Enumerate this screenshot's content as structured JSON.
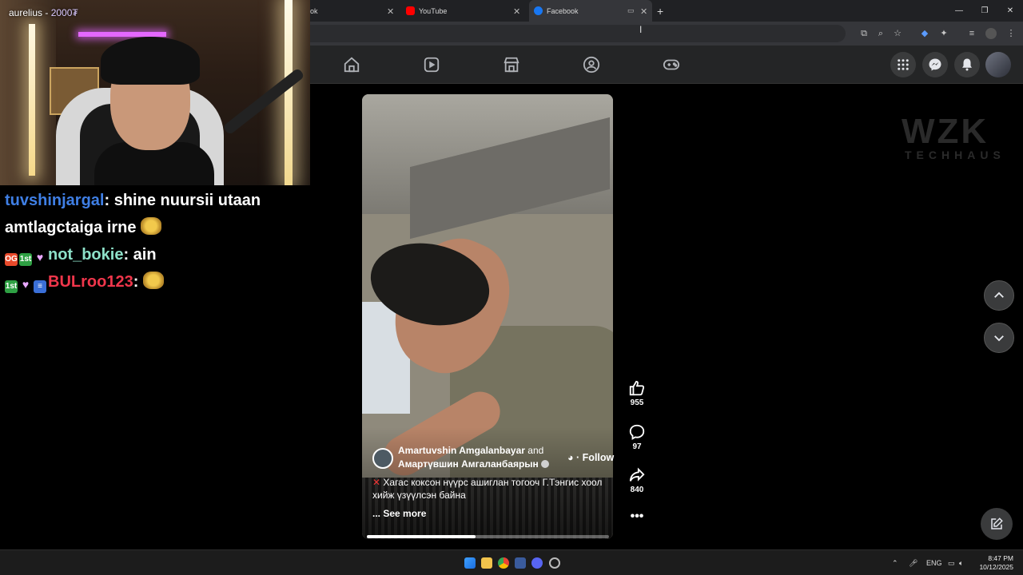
{
  "stream": {
    "cam_title_name": "aurelius - ",
    "cam_title_amount": "2000₮",
    "chat": [
      {
        "user": "tuvshinjargal",
        "message": " shine nuursii utaan",
        "continuation": "amtlagctaiga irne"
      },
      {
        "badges": [
          "OG",
          "1st"
        ],
        "user": "not_bokie",
        "message": " ain"
      },
      {
        "badges": [
          "1st"
        ],
        "user": "BULroo123",
        "message": ""
      }
    ]
  },
  "browser": {
    "tabs": [
      {
        "label": "ok",
        "favicon_color": "#1877f2"
      },
      {
        "label": "YouTube",
        "favicon_color": "#ff0000"
      },
      {
        "label": "Facebook",
        "favicon_color": "#1877f2"
      }
    ],
    "new_tab_icon": "plus-icon",
    "window_controls": [
      "minimize-icon",
      "restore-icon",
      "close-icon"
    ]
  },
  "reel": {
    "author": "Amartuvshin Amgalanbayar",
    "and": " and",
    "author2": "Амартүвшин Амгаланбаярын",
    "follow": "· Follow",
    "caption": "Хагас коксон нүүрс ашиглан тогооч Г.Тэнгис хоол хийж үзүүлсэн байна",
    "see_more": "... See more",
    "progress": 0.45,
    "likes": "955",
    "comments": "97",
    "shares": "840"
  },
  "watermark": {
    "title": "WZK",
    "subtitle": "TECHHAUS"
  },
  "taskbar": {
    "language": "ENG",
    "time": "8:47 PM",
    "date": "10/12/2025"
  },
  "colors": {
    "fb_blue": "#1877f2",
    "chat_blue": "#3f7fe5",
    "chat_teal": "#8de0c8",
    "chat_red": "#f0364b"
  }
}
